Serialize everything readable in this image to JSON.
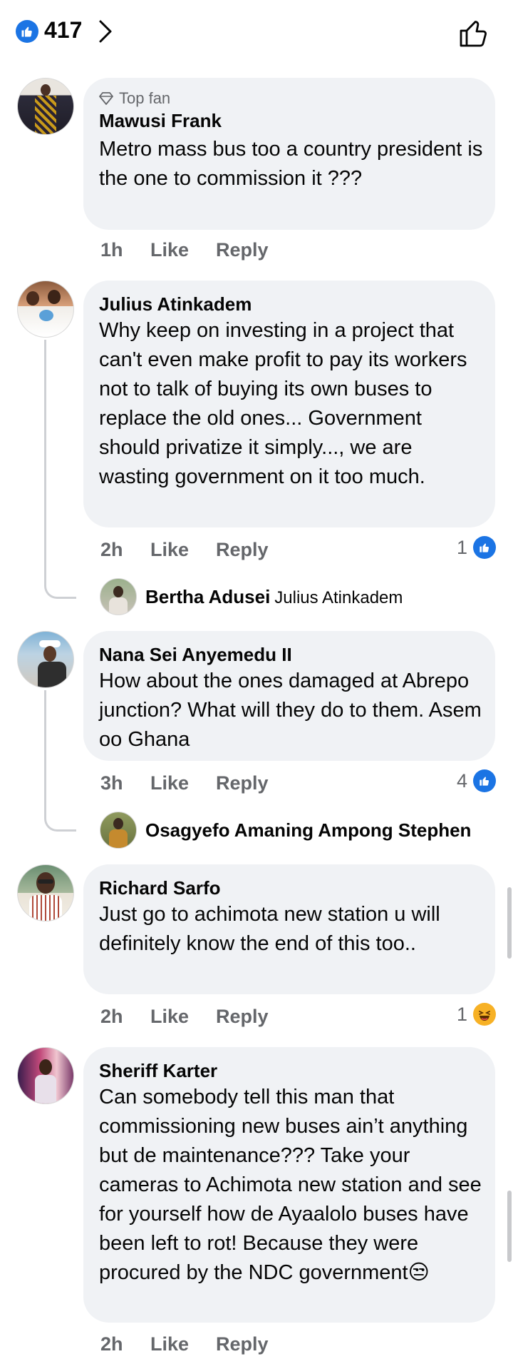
{
  "header": {
    "like_count": "417"
  },
  "comments": [
    {
      "badge": "Top fan",
      "name": "Mawusi Frank",
      "text": "Metro mass bus too a country president is the one to commission it  ???",
      "time": "1h",
      "like": "Like",
      "reply": "Reply"
    },
    {
      "name": "Julius Atinkadem",
      "text": "Why keep on investing in a project that can't even make profit to pay its workers not to talk of buying its own buses to replace the old ones... Government should privatize it simply..., we are wasting government on it too much.",
      "time": "2h",
      "like": "Like",
      "reply": "Reply",
      "reaction_count": "1",
      "reply_author": "Bertha Adusei",
      "reply_tag": "Julius Atinkadem"
    },
    {
      "name": "Nana Sei Anyemedu II",
      "text": "How about the ones damaged at Abrepo junction?  What will they do to them. Asem oo Ghana",
      "time": "3h",
      "like": "Like",
      "reply": "Reply",
      "reaction_count": "4",
      "reply_author": "Osagyefo Amaning Ampong Stephen"
    },
    {
      "name": "Richard Sarfo",
      "text": "Just go to achimota new station u will definitely know the end of this too..",
      "time": "2h",
      "like": "Like",
      "reply": "Reply",
      "reaction_count": "1"
    },
    {
      "name": "Sheriff Karter",
      "text": "Can somebody tell this man that commissioning new buses ain’t anything but de maintenance??? Take your cameras to Achimota new station and see for yourself how de Ayaalolo buses have been left to rot! Because they were procured by the NDC government😒",
      "time": "2h",
      "like": "Like",
      "reply": "Reply"
    }
  ]
}
